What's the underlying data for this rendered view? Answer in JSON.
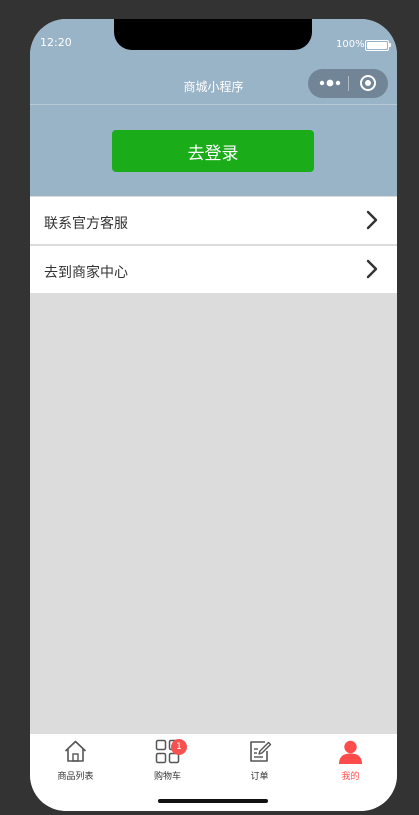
{
  "status_bar": {
    "time": "12:20",
    "battery": "100%"
  },
  "nav": {
    "title": "商城小程序"
  },
  "login": {
    "button_label": "去登录"
  },
  "menu": {
    "items": [
      {
        "label": "联系官方客服"
      },
      {
        "label": "去到商家中心"
      }
    ]
  },
  "tabbar": {
    "tabs": [
      {
        "label": "商品列表",
        "icon": "home-icon"
      },
      {
        "label": "购物车",
        "icon": "grid-icon",
        "badge": "1"
      },
      {
        "label": "订单",
        "icon": "order-icon"
      },
      {
        "label": "我的",
        "icon": "user-icon",
        "active": true
      }
    ]
  },
  "colors": {
    "header": "#99b3c7",
    "login_button": "#1aad19",
    "active_tab": "#ff4b4b",
    "badge": "#f65151",
    "background": "#dcdcdc"
  }
}
